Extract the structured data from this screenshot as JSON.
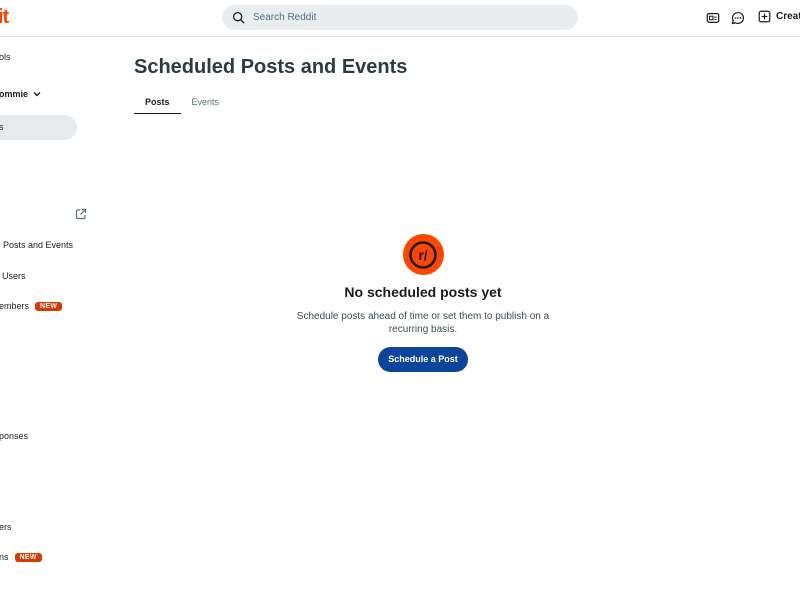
{
  "header": {
    "logo_fragment": "it",
    "search": {
      "placeholder": "Search Reddit",
      "value": ""
    },
    "create_label": "Creat"
  },
  "sidebar": {
    "items": [
      {
        "label": "ols"
      },
      {
        "label": "ommie"
      },
      {
        "label": "s"
      },
      {
        "label": "Posts and Events"
      },
      {
        "label": "Users"
      },
      {
        "label": "embers",
        "badge": "NEW"
      },
      {
        "label": "ponses"
      },
      {
        "label": "ers"
      },
      {
        "label": "ns",
        "badge": "NEW"
      }
    ]
  },
  "main": {
    "title": "Scheduled Posts and Events",
    "tabs": [
      {
        "label": "Posts",
        "active": true
      },
      {
        "label": "Events",
        "active": false
      }
    ],
    "empty": {
      "icon": "r/",
      "title": "No scheduled posts yet",
      "description": "Schedule posts ahead of time or set them to publish on a recurring basis.",
      "button": "Schedule a Post"
    }
  },
  "colors": {
    "brand": "#ff4500",
    "primary_button": "#0a449b",
    "badge": "#d93a00"
  }
}
